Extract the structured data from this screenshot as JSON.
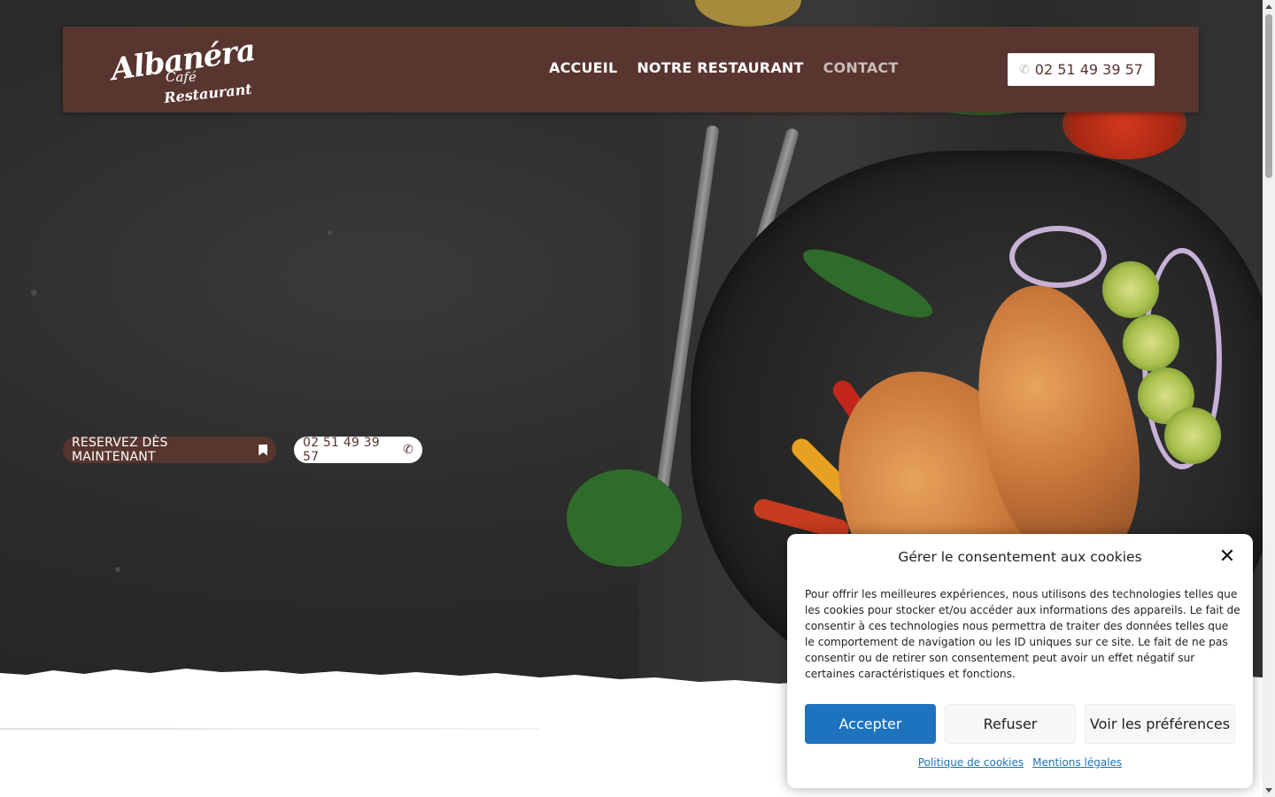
{
  "header": {
    "logo_line1": "Albanéra",
    "logo_line2": "Café",
    "logo_line3": "Restaurant",
    "nav": [
      {
        "label": "ACCUEIL"
      },
      {
        "label": "NOTRE RESTAURANT"
      },
      {
        "label": "CONTACT"
      }
    ],
    "phone": "02 51 49 39 57",
    "phone_icon": "phone-icon"
  },
  "hero": {
    "reserve_label": "RESERVEZ DÈS MAINTENANT",
    "reserve_icon": "bookmark-icon",
    "phone_label": "02 51 49 39 57",
    "phone_icon": "phone-icon"
  },
  "cookie": {
    "title": "Gérer le consentement aux cookies",
    "text": "Pour offrir les meilleures expériences, nous utilisons des technologies telles que les cookies pour stocker et/ou accéder aux informations des appareils. Le fait de consentir à ces technologies nous permettra de traiter des données telles que le comportement de navigation ou les ID uniques sur ce site. Le fait de ne pas consentir ou de retirer son consentement peut avoir un effet négatif sur certaines caractéristiques et fonctions.",
    "accept_label": "Accepter",
    "refuse_label": "Refuser",
    "prefs_label": "Voir les préférences",
    "policy_link": "Politique de cookies",
    "legal_link": "Mentions légales"
  },
  "colors": {
    "brand": "#58352f",
    "accept": "#1e73be"
  }
}
